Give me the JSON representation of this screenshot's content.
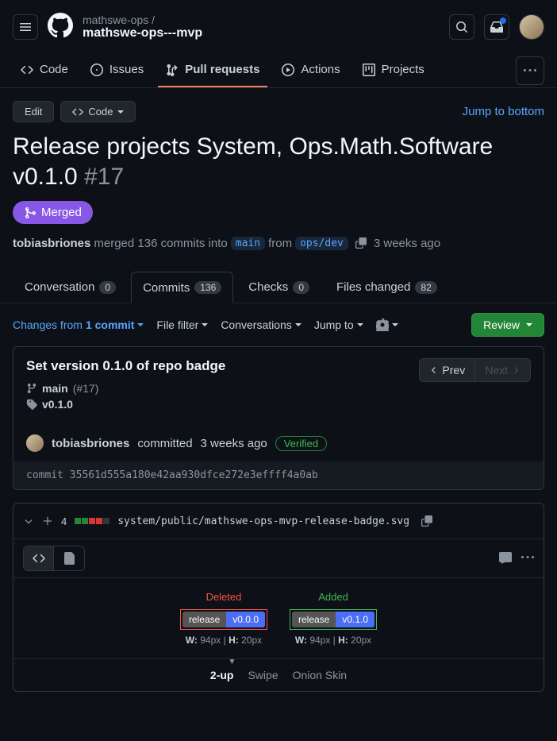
{
  "header": {
    "owner": "mathswe-ops /",
    "repo_name": "mathswe-ops---mvp"
  },
  "nav": {
    "code": "Code",
    "issues": "Issues",
    "pull_requests": "Pull requests",
    "actions": "Actions",
    "projects": "Projects"
  },
  "pr_header": {
    "edit": "Edit",
    "code_btn": "Code",
    "jump_to_bottom": "Jump to bottom",
    "title": "Release projects System, Ops.Math.Software v0.1.0",
    "number": "#17",
    "merged_label": "Merged",
    "author": "tobiasbriones",
    "merged_text_1": "merged 136 commits into",
    "branch_into": "main",
    "from_text": "from",
    "branch_from": "ops/dev",
    "time_ago": "3 weeks ago"
  },
  "pr_tabs": {
    "conversation": "Conversation",
    "conversation_count": "0",
    "commits": "Commits",
    "commits_count": "136",
    "checks": "Checks",
    "checks_count": "0",
    "files": "Files changed",
    "files_count": "82"
  },
  "toolbar": {
    "changes_from": "Changes from",
    "commit_count": "1 commit",
    "file_filter": "File filter",
    "conversations": "Conversations",
    "jump_to": "Jump to",
    "review": "Review"
  },
  "commit": {
    "title": "Set version 0.1.0 of repo badge",
    "branch": "main",
    "pr_ref": "(#17)",
    "tag": "v0.1.0",
    "prev": "Prev",
    "next": "Next",
    "author": "tobiasbriones",
    "committed": "committed",
    "time_ago": "3 weeks ago",
    "verified": "Verified",
    "hash_label": "commit",
    "hash": "35561d555a180e42aa930dfce272e3effff4a0ab"
  },
  "file": {
    "changes": "4",
    "path": "system/public/mathswe-ops-mvp-release-badge.svg"
  },
  "diff": {
    "deleted": "Deleted",
    "added": "Added",
    "badge_label": "release",
    "badge_deleted_val": "v0.0.0",
    "badge_added_val": "v0.1.0",
    "w_label": "W:",
    "h_label": "H:",
    "w_val": "94px",
    "h_val": "20px",
    "sep": " | "
  },
  "view_modes": {
    "two_up": "2-up",
    "swipe": "Swipe",
    "onion": "Onion Skin"
  }
}
